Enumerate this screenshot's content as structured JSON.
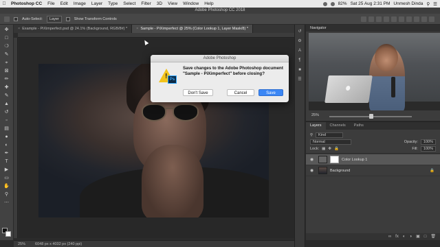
{
  "menubar": {
    "apple": "",
    "app": "Photoshop CC",
    "items": [
      "File",
      "Edit",
      "Image",
      "Layer",
      "Type",
      "Select",
      "Filter",
      "3D",
      "View",
      "Window",
      "Help"
    ],
    "battery": "82%",
    "datetime": "Sat 25 Aug  2:31 PM",
    "user": "Unmesh Dinda"
  },
  "window_title": "Adobe Photoshop CC 2018",
  "options": {
    "auto_select_label": "Auto-Select:",
    "auto_select_value": "Layer",
    "transform_label": "Show Transform Controls"
  },
  "tabs": [
    {
      "label": "Example - PiXimperfect.psd @ 24.1% (Background, RGB/8#) *",
      "active": false
    },
    {
      "label": "Sample - PiXimperfect @ 25% (Color Lookup 1, Layer Mask/8) *",
      "active": true
    }
  ],
  "dialog": {
    "title": "Adobe Photoshop",
    "message": "Save changes to the Adobe Photoshop document \"Sample - PiXimperfect\" before closing?",
    "icon_badge": "Ps",
    "dont_save": "Don't Save",
    "cancel": "Cancel",
    "save": "Save",
    "accent": "#3b87f5"
  },
  "navigator": {
    "title": "Navigator",
    "zoom": "25%"
  },
  "layers_panel": {
    "tabs": [
      "Layers",
      "Channels",
      "Paths"
    ],
    "kind": "Kind",
    "blend": "Normal",
    "opacity_label": "Opacity:",
    "opacity": "100%",
    "lock_label": "Lock:",
    "fill_label": "Fill:",
    "fill": "100%",
    "layers": [
      {
        "name": "Color Lookup 1",
        "selected": true
      },
      {
        "name": "Background",
        "selected": false
      }
    ]
  },
  "status": {
    "zoom": "25%",
    "doc_size": "6048 px x 4032 px (240 ppi)"
  }
}
